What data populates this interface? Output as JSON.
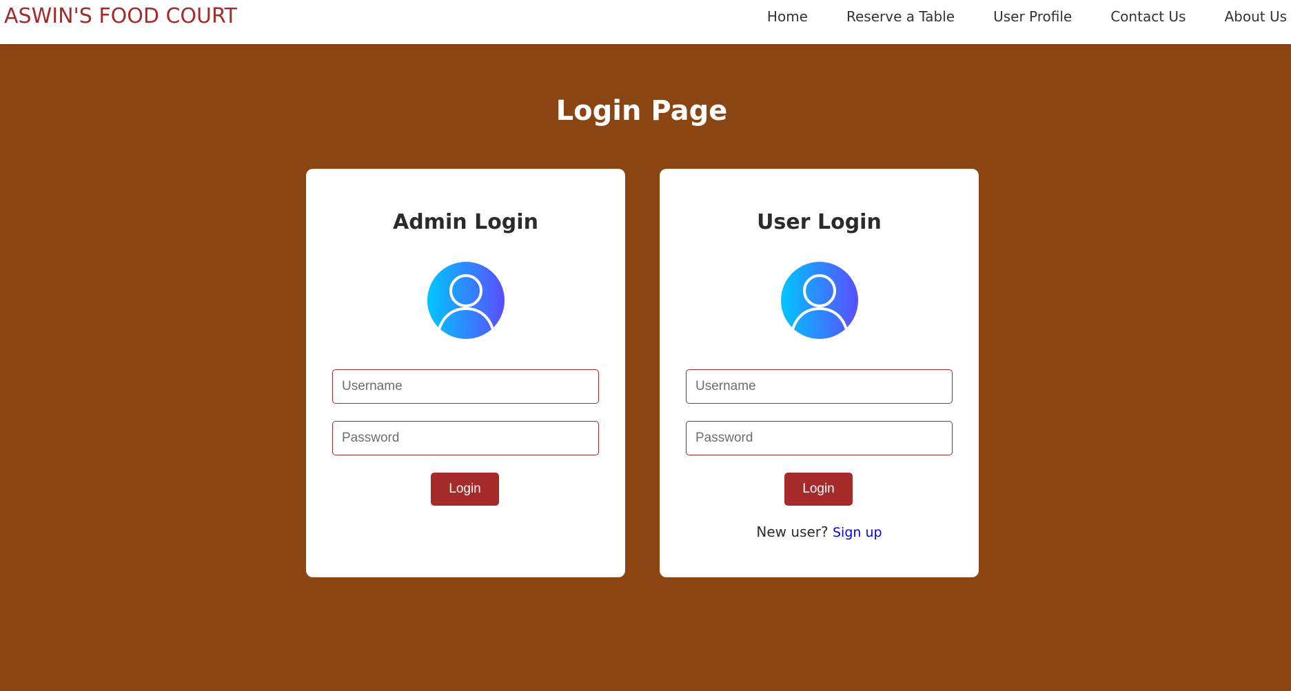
{
  "brand": "ASWIN'S FOOD COURT",
  "nav": {
    "items": [
      "Home",
      "Reserve a Table",
      "User Profile",
      "Contact Us",
      "About Us"
    ]
  },
  "page_title": "Login Page",
  "admin": {
    "heading": "Admin Login",
    "avatar_icon": "user-avatar-icon",
    "username_placeholder": "Username",
    "password_placeholder": "Password",
    "login_label": "Login"
  },
  "user": {
    "heading": "User Login",
    "avatar_icon": "user-avatar-icon",
    "username_placeholder": "Username",
    "password_placeholder": "Password",
    "login_label": "Login",
    "signup_prompt": "New user?",
    "signup_link": "Sign up"
  },
  "colors": {
    "background": "#8b4513",
    "accent": "#a52a2a",
    "avatar_gradient_start": "#00c6ff",
    "avatar_gradient_end": "#5b4dff",
    "link": "#0000ee"
  }
}
